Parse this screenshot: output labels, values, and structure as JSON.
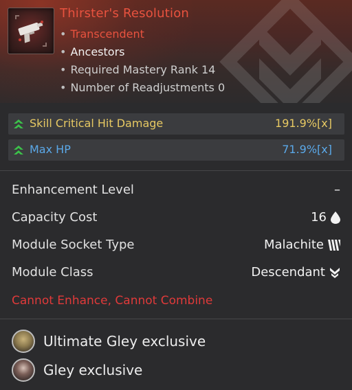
{
  "item": {
    "title": "Thirster's Resolution",
    "rarity": "Transcendent",
    "tag": "Ancestors",
    "required_mastery": "Required Mastery Rank 14",
    "readjustments": "Number of Readjustments 0"
  },
  "stats": [
    {
      "label": "Skill Critical Hit Damage",
      "value": "191.9%[x]",
      "color": "#e7c963",
      "icon": "double-up-arrow-icon"
    },
    {
      "label": "Max HP",
      "value": "71.9%[x]",
      "color": "#5ba9e9",
      "icon": "double-up-arrow-icon"
    }
  ],
  "properties": [
    {
      "label": "Enhancement Level",
      "value": "–"
    },
    {
      "label": "Capacity Cost",
      "value": "16",
      "icon": "droplet-icon"
    },
    {
      "label": "Module Socket Type",
      "value": "Malachite",
      "icon": "malachite-socket-icon"
    },
    {
      "label": "Module Class",
      "value": "Descendant",
      "icon": "descendant-class-icon"
    }
  ],
  "warning": "Cannot Enhance, Cannot Combine",
  "exclusives": [
    {
      "label": "Ultimate Gley exclusive"
    },
    {
      "label": "Gley exclusive"
    }
  ],
  "colors": {
    "title": "#e8523f",
    "warning": "#e03a3a",
    "stat_gold": "#e7c963",
    "stat_blue": "#5ba9e9",
    "arrow_green": "#3cc24a"
  }
}
